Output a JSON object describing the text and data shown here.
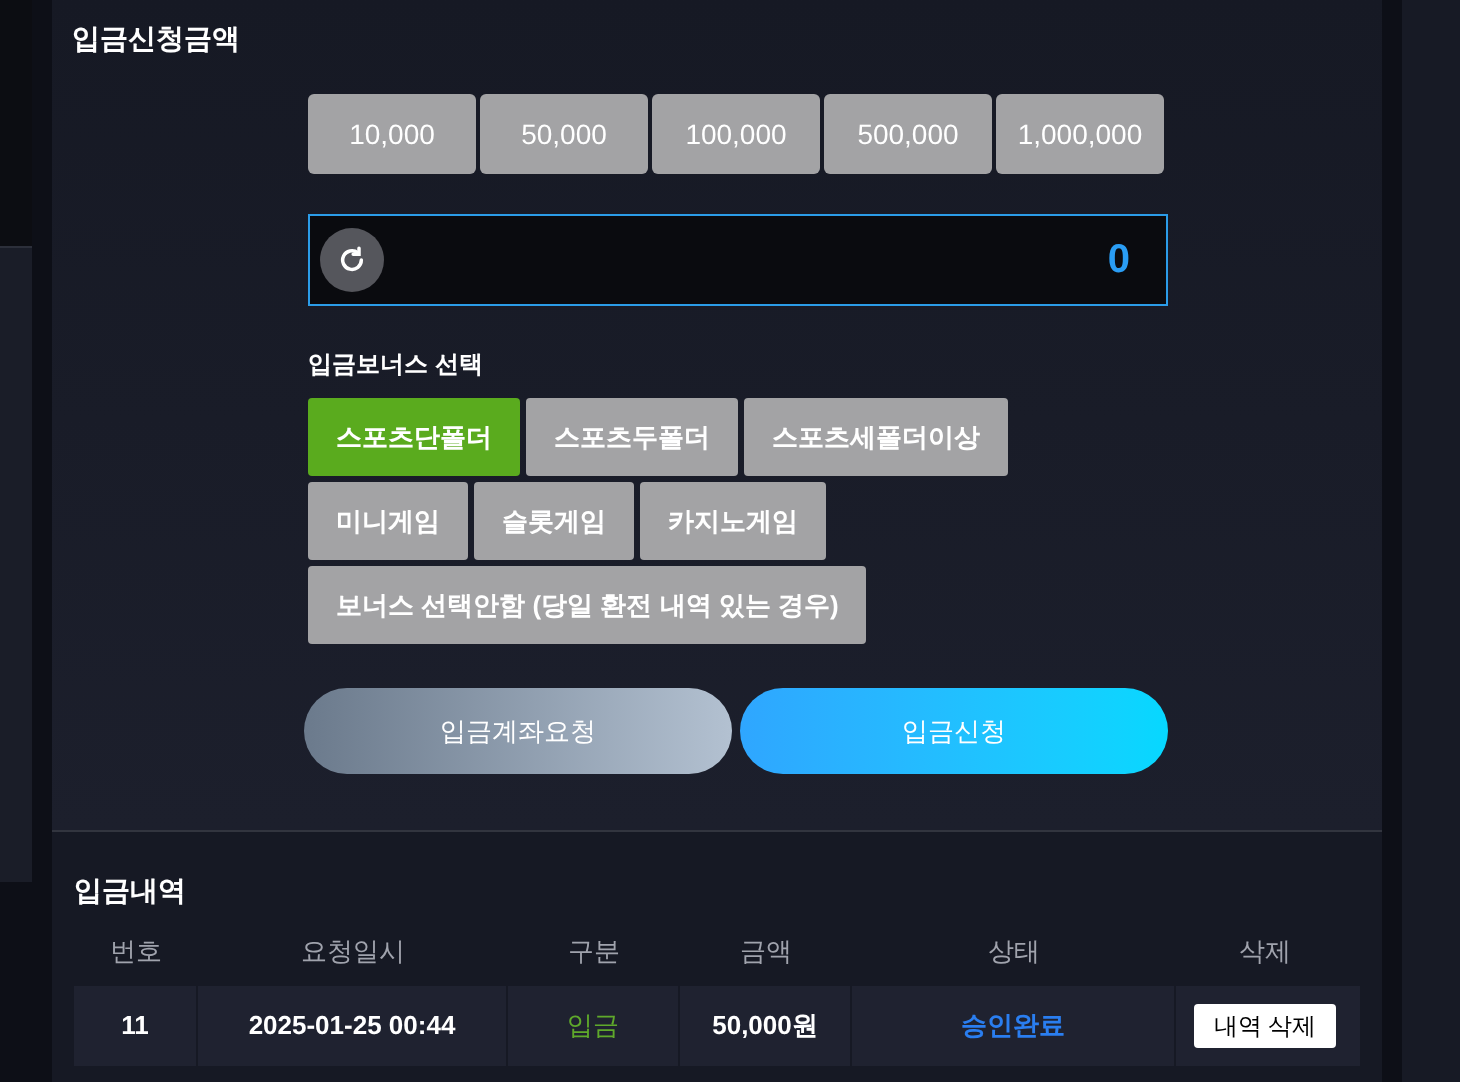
{
  "amount_section": {
    "title": "입금신청금액",
    "quick_amounts": [
      "10,000",
      "50,000",
      "100,000",
      "500,000",
      "1,000,000"
    ],
    "amount_field": {
      "value": "0"
    },
    "bonus_label": "입금보너스 선택",
    "bonus_rows": [
      [
        {
          "label": "스포츠단폴더",
          "selected": true
        },
        {
          "label": "스포츠두폴더",
          "selected": false
        },
        {
          "label": "스포츠세폴더이상",
          "selected": false
        }
      ],
      [
        {
          "label": "미니게임",
          "selected": false
        },
        {
          "label": "슬롯게임",
          "selected": false
        },
        {
          "label": "카지노게임",
          "selected": false
        }
      ],
      [
        {
          "label": "보너스 선택안함 (당일 환전 내역 있는 경우)",
          "selected": false
        }
      ]
    ],
    "actions": [
      {
        "label": "입금계좌요청",
        "kind": "secondary"
      },
      {
        "label": "입금신청",
        "kind": "primary"
      }
    ]
  },
  "history": {
    "title": "입금내역",
    "columns": [
      "번호",
      "요청일시",
      "구분",
      "금액",
      "상태",
      "삭제"
    ],
    "rows": [
      {
        "number": "11",
        "requested_at": "2025-01-25 00:44",
        "type": "입금",
        "amount": "50,000원",
        "status": "승인완료",
        "delete": "내역 삭제"
      }
    ]
  }
}
